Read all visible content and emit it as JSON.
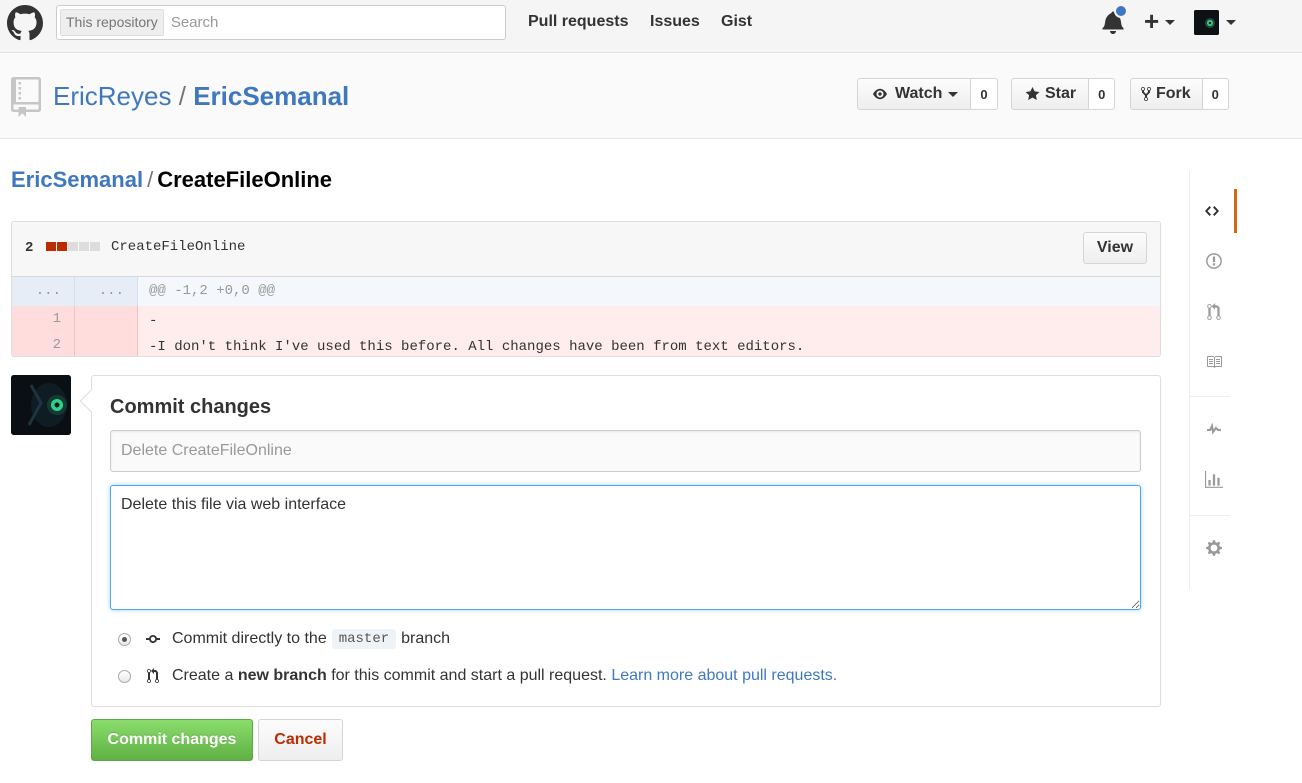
{
  "header": {
    "search": {
      "scope": "This repository",
      "placeholder": "Search"
    },
    "nav": [
      "Pull requests",
      "Issues",
      "Gist"
    ]
  },
  "repo": {
    "owner": "EricReyes",
    "separator": "/",
    "name": "EricSemanal",
    "watch": {
      "label": "Watch",
      "count": "0"
    },
    "star": {
      "label": "Star",
      "count": "0"
    },
    "fork": {
      "label": "Fork",
      "count": "0"
    }
  },
  "breadcrumb": {
    "root": "EricSemanal",
    "separator": "/",
    "file": "CreateFileOnline"
  },
  "diff": {
    "stat": "2",
    "file_name": "CreateFileOnline",
    "view_label": "View",
    "hunk": {
      "old": "...",
      "new": "...",
      "text": "@@ -1,2 +0,0 @@"
    },
    "lines": [
      {
        "old": "1",
        "new": "",
        "text": "-"
      },
      {
        "old": "2",
        "new": "",
        "text": "-I don't think I've used this before. All changes have been from text editors."
      }
    ]
  },
  "commit": {
    "title": "Commit changes",
    "summary_placeholder": "Delete CreateFileOnline",
    "description": "Delete this file via web interface",
    "option_direct": {
      "prefix": "Commit directly to the",
      "branch": "master",
      "suffix": "branch"
    },
    "option_new": {
      "prefix": "Create a",
      "bold": "new branch",
      "middle": "for this commit and start a pull request.",
      "link": "Learn more about pull requests."
    },
    "submit_label": "Commit changes",
    "cancel_label": "Cancel"
  },
  "colors": {
    "link": "#4078c0",
    "deleted_block": "#bd2c00",
    "submit_green": "#60b044",
    "cancel_red": "#bd2c00",
    "active_nav": "#d26911"
  },
  "icons": {
    "sidebar": [
      "code-icon",
      "issue-icon",
      "pull-request-icon",
      "wiki-icon",
      "pulse-icon",
      "graph-icon",
      "settings-icon"
    ]
  }
}
